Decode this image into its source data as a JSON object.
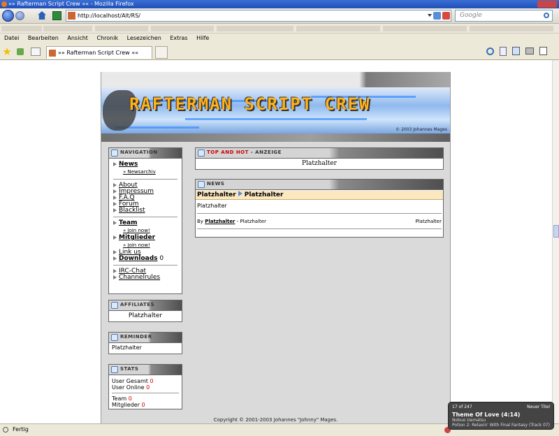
{
  "browser": {
    "window_title": "»» Rafterman Script Crew «« - Mozilla Firefox",
    "url": "http://localhost/Alt/RS/",
    "search_placeholder": "Google",
    "menu": [
      "Datei",
      "Bearbeiten",
      "Ansicht",
      "Chronik",
      "Lesezeichen",
      "Extras",
      "Hilfe"
    ],
    "tab_title": "»» Rafterman Script Crew ««",
    "status": "Fertig"
  },
  "site": {
    "banner_title": "RAFTERMAN SCRIPT CREW",
    "banner_copyright": "© 2003 Johannes Mages",
    "footer": "Copyright © 2001-2003 Johannes \"Johnny\" Mages."
  },
  "navigation": {
    "header": "NAVIGATION",
    "news": "News",
    "newsarchiv": "Newsarchiv",
    "about": "About",
    "impressum": "Impressum",
    "faq": "F.A.Q",
    "forum": "Forum",
    "blacklist": "Blacklist",
    "team": "Team",
    "join1": "Join now!",
    "mitglieder": "Mitglieder",
    "join2": "Join now!",
    "linkus": "Link us",
    "downloads": "Downloads",
    "downloads_count": "0",
    "irc": "IRC-Chat",
    "channelrules": "Channelrules"
  },
  "affiliates": {
    "header": "AFFILIATES",
    "text": "Platzhalter"
  },
  "reminder": {
    "header": "REMINDER",
    "text": "Platzhalter"
  },
  "stats": {
    "header": "STATS",
    "user_gesamt_label": "User Gesamt",
    "user_gesamt": "0",
    "user_online_label": "User Online",
    "user_online": "0",
    "team_label": "Team",
    "team": "0",
    "mitglieder_label": "Mitglieder",
    "mitglieder": "0"
  },
  "top": {
    "header_red": "TOP AND HOT",
    "header_rest": "- ANZEIGE",
    "text": "Platzhalter"
  },
  "newsbox": {
    "header": "NEWS",
    "cat": "Platzhalter",
    "title": "Platzhalter",
    "body": "Platzhalter",
    "by": "By",
    "author": "Platzhalter",
    "sep": "- Platzhalter",
    "right": "Platzhalter"
  },
  "player": {
    "count": "17 of 247",
    "next": "Neuer Titel",
    "title": "Theme Of Love (4:14)",
    "artist": "Nobuo Uematsu",
    "album": "Potion 2: Relaxin' With Final Fantasy (Track 07)"
  }
}
